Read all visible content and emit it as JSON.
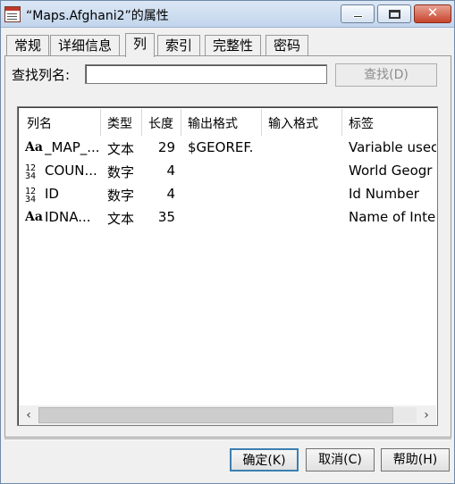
{
  "window": {
    "title": "“Maps.Afghani2”的属性"
  },
  "tabs": [
    {
      "label": "常规"
    },
    {
      "label": "详细信息"
    },
    {
      "label": "列"
    },
    {
      "label": "索引"
    },
    {
      "label": "完整性"
    },
    {
      "label": "密码"
    }
  ],
  "active_tab": "列",
  "search": {
    "label": "查找列名:",
    "value": "",
    "button_label": "查找(D)"
  },
  "columns": {
    "headers": [
      "列名",
      "类型",
      "长度",
      "输出格式",
      "输入格式",
      "标签"
    ],
    "rows": [
      {
        "icon": "char-type-icon",
        "name": "_MAP_...",
        "type": "文本",
        "length": "29",
        "out_format": "$GEOREF.",
        "in_format": "",
        "label": "Variable usec"
      },
      {
        "icon": "numeric-type-icon",
        "name": "COUN...",
        "type": "数字",
        "length": "4",
        "out_format": "",
        "in_format": "",
        "label": "World Geogr"
      },
      {
        "icon": "numeric-type-icon",
        "name": "ID",
        "type": "数字",
        "length": "4",
        "out_format": "",
        "in_format": "",
        "label": "Id Number"
      },
      {
        "icon": "char-type-icon",
        "name": "IDNA...",
        "type": "文本",
        "length": "35",
        "out_format": "",
        "in_format": "",
        "label": "Name of Inte"
      }
    ]
  },
  "footer": {
    "ok_label": "确定(K)",
    "cancel_label": "取消(C)",
    "help_label": "帮助(H)"
  },
  "icons": {
    "char": "Aa",
    "numeric": "12\n34"
  },
  "colors": {
    "title_gradient_top": "#dbe7f5",
    "close_button": "#c7442c",
    "default_button_border": "#3c7fb1"
  }
}
